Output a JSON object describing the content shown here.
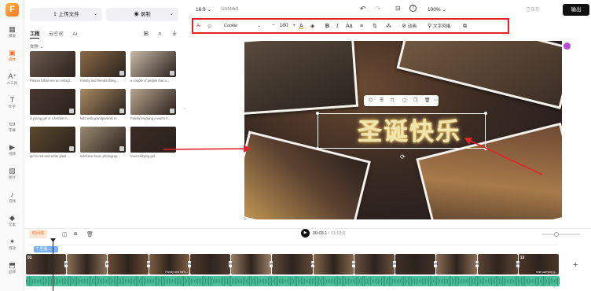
{
  "rail": {
    "items": [
      {
        "label": "模版",
        "icon": "template-icon",
        "glyph": "▦"
      },
      {
        "label": "媒体",
        "icon": "media-icon",
        "glyph": "▣"
      },
      {
        "label": "AI工具",
        "icon": "ai-tools-icon",
        "glyph": "A⁺"
      },
      {
        "label": "文字",
        "icon": "text-icon",
        "glyph": "T"
      },
      {
        "label": "字幕",
        "icon": "subtitle-icon",
        "glyph": "▭"
      },
      {
        "label": "视频",
        "icon": "video-icon",
        "glyph": "▶"
      },
      {
        "label": "图片",
        "icon": "image-icon",
        "glyph": "▨"
      },
      {
        "label": "音频",
        "icon": "audio-icon",
        "glyph": "♪"
      },
      {
        "label": "元素",
        "icon": "elements-icon",
        "glyph": "◆"
      },
      {
        "label": "特效",
        "icon": "effects-icon",
        "glyph": "✦"
      },
      {
        "label": "品牌",
        "icon": "brand-icon",
        "glyph": "⬒"
      }
    ]
  },
  "panel": {
    "upload_label": "上传文件",
    "record_label": "录制",
    "tabs": [
      {
        "label": "工程"
      },
      {
        "label": "云空间"
      },
      {
        "label": "AI"
      }
    ],
    "filter_label": "文件",
    "media": [
      {
        "caption": "Please follow me on instagr...",
        "color": "#6d5b4f",
        "checked": false
      },
      {
        "caption": "Family and friends doing...",
        "color": "#8a6a48",
        "checked": true
      },
      {
        "caption": "a couple of people that a...",
        "color": "#c9b9a8",
        "checked": true
      },
      {
        "caption": "A young girl in a festive m...",
        "color": "#4a3832",
        "checked": true
      },
      {
        "caption": "kids with grandparents m...",
        "color": "#a98a63",
        "checked": true
      },
      {
        "caption": "Family enjoying a warm h...",
        "color": "#b8a48e",
        "checked": true
      },
      {
        "caption": "girl in red and white plaid ...",
        "color": "#5b4a2e",
        "checked": true
      },
      {
        "caption": "selective focus photograp...",
        "color": "#9b8a74",
        "checked": true
      },
      {
        "caption": "man carrying girl",
        "color": "#3a2c24",
        "checked": false
      }
    ]
  },
  "topbar": {
    "aspect": "16:9",
    "title": "Untitled",
    "zoom": "100%",
    "saved": "已保存",
    "export": "输出"
  },
  "toolbar": {
    "font": "Cookie",
    "font_size": "180",
    "animation_label": "动画",
    "text_style_label": "文字风格"
  },
  "canvas": {
    "text": "圣诞快乐"
  },
  "timeline": {
    "split_label": "时间线",
    "current_time": "00:03.1",
    "total_time": "/ 01:03.0",
    "text_clip_label": "T 圣诞...",
    "clips": [
      {
        "num": "01",
        "label": "",
        "color": "#5a4538"
      },
      {
        "num": "",
        "label": "",
        "color": "#8c7258"
      },
      {
        "num": "",
        "label": "",
        "color": "#6b4c35"
      },
      {
        "num": "",
        "label": "Family and frien...",
        "color": "#7d5d40"
      },
      {
        "num": "",
        "label": "",
        "color": "#4e3a2e"
      },
      {
        "num": "",
        "label": "",
        "color": "#9a8068"
      },
      {
        "num": "",
        "label": "",
        "color": "#5f4a39"
      },
      {
        "num": "",
        "label": "",
        "color": "#84674b"
      },
      {
        "num": "",
        "label": "",
        "color": "#6a5240"
      },
      {
        "num": "",
        "label": "",
        "color": "#3f3029"
      },
      {
        "num": "",
        "label": "",
        "color": "#8b6f55"
      },
      {
        "num": "",
        "label": "",
        "color": "#5c4637"
      },
      {
        "num": "13",
        "label": "man carrying g...",
        "color": "#4b3628"
      }
    ]
  }
}
